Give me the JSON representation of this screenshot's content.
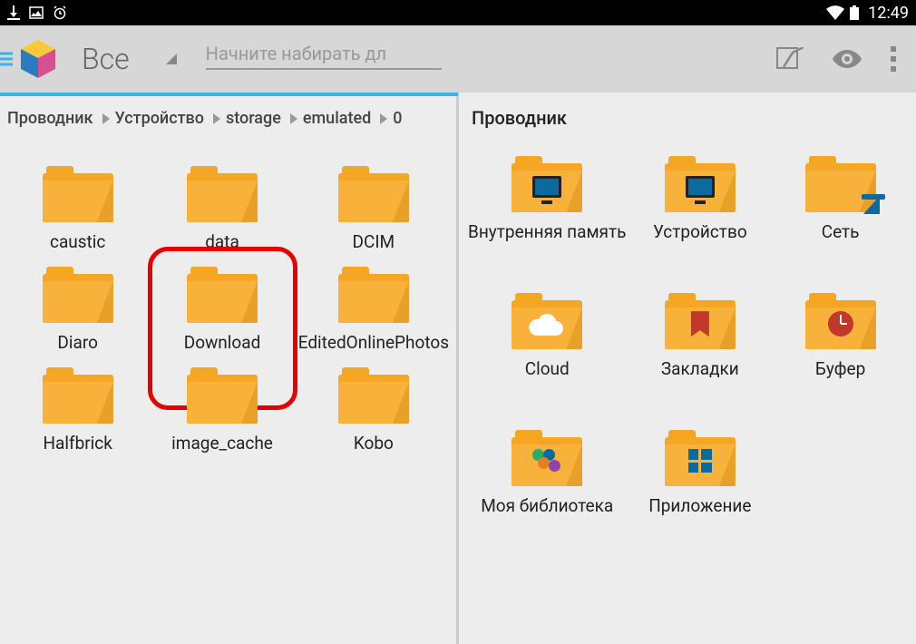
{
  "status_bar": {
    "time": "12:49"
  },
  "app_bar": {
    "filter_label": "Все",
    "search_placeholder": "Начните набирать дл"
  },
  "left_pane": {
    "breadcrumbs": [
      "Проводник",
      "Устройство",
      "storage",
      "emulated",
      "0"
    ],
    "folders": [
      {
        "label": "caustic"
      },
      {
        "label": "data"
      },
      {
        "label": "DCIM"
      },
      {
        "label": "Diaro"
      },
      {
        "label": "Download",
        "highlighted": true
      },
      {
        "label": "EditedOnlinePhotos"
      },
      {
        "label": "Halfbrick"
      },
      {
        "label": "image_cache"
      },
      {
        "label": "Kobo"
      }
    ]
  },
  "right_pane": {
    "title": "Проводник",
    "items": [
      {
        "label": "Внутренняя память",
        "overlay": "screen"
      },
      {
        "label": "Устройство",
        "overlay": "screen"
      },
      {
        "label": "Сеть",
        "overlay": "network"
      },
      {
        "label": "Cloud",
        "overlay": "cloud"
      },
      {
        "label": "Закладки",
        "overlay": "bookmark"
      },
      {
        "label": "Буфер",
        "overlay": "clock"
      },
      {
        "label": "Моя библиотека",
        "overlay": "circles"
      },
      {
        "label": "Приложение",
        "overlay": "apps"
      }
    ]
  }
}
